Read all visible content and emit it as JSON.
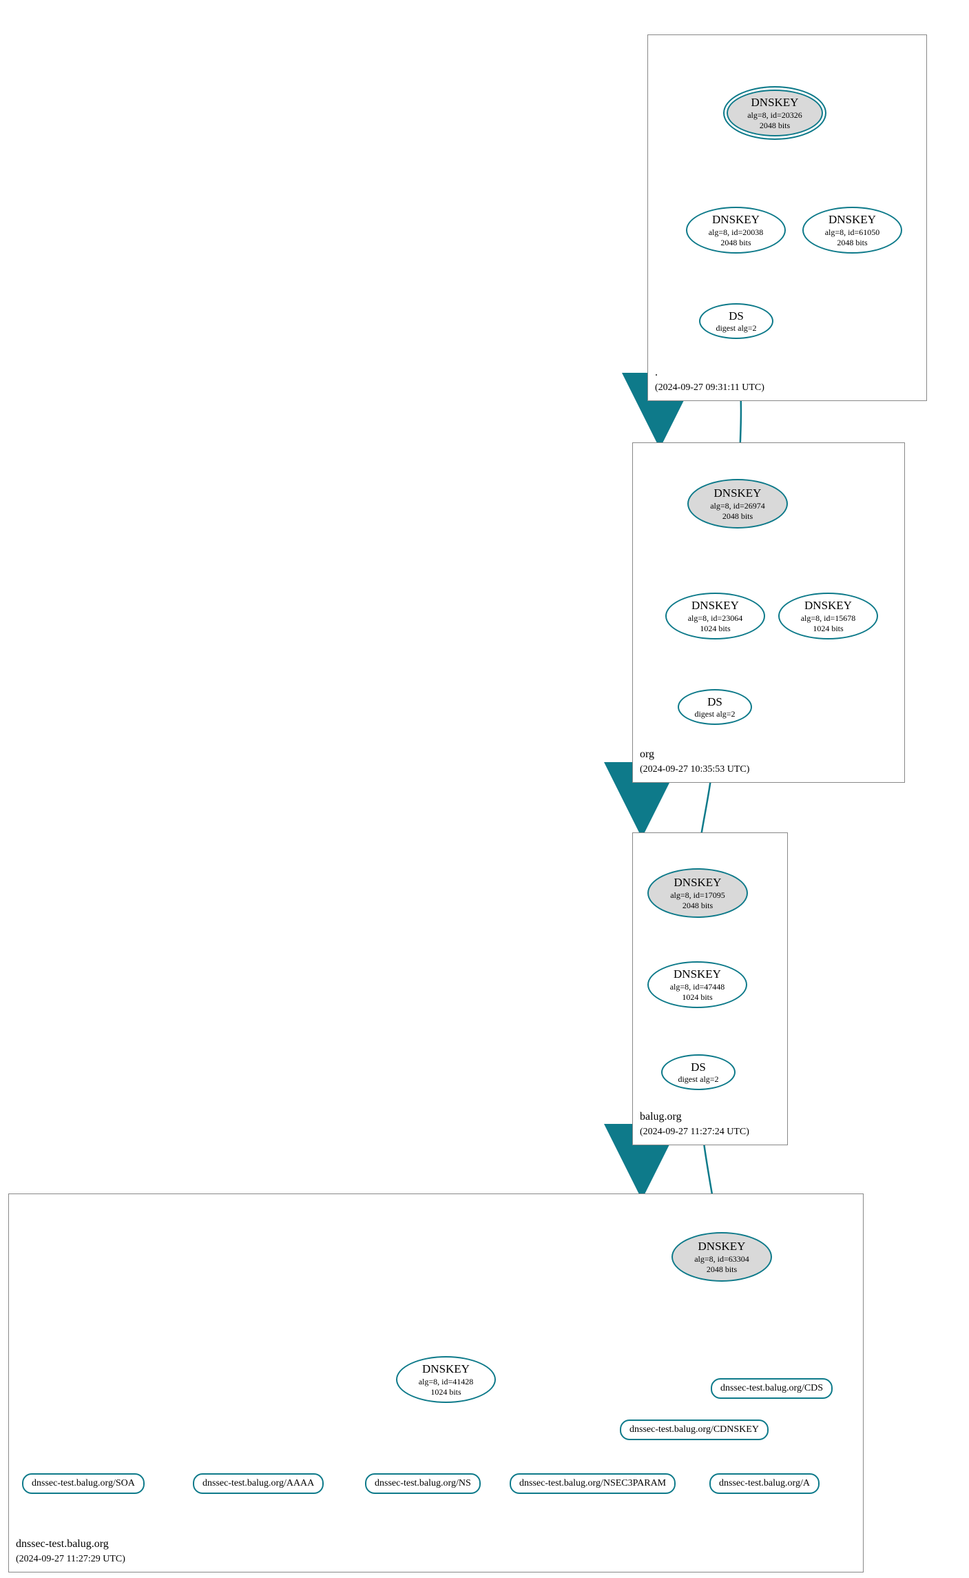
{
  "zones": {
    "root": {
      "name": ".",
      "timestamp": "(2024-09-27 09:31:11 UTC)"
    },
    "org": {
      "name": "org",
      "timestamp": "(2024-09-27 10:35:53 UTC)"
    },
    "balug": {
      "name": "balug.org",
      "timestamp": "(2024-09-27 11:27:24 UTC)"
    },
    "test": {
      "name": "dnssec-test.balug.org",
      "timestamp": "(2024-09-27 11:27:29 UTC)"
    }
  },
  "nodes": {
    "root_ksk": {
      "title": "DNSKEY",
      "line2": "alg=8, id=20326",
      "line3": "2048 bits"
    },
    "root_zsk": {
      "title": "DNSKEY",
      "line2": "alg=8, id=20038",
      "line3": "2048 bits"
    },
    "root_extra": {
      "title": "DNSKEY",
      "line2": "alg=8, id=61050",
      "line3": "2048 bits"
    },
    "root_ds": {
      "title": "DS",
      "line2": "digest alg=2"
    },
    "org_ksk": {
      "title": "DNSKEY",
      "line2": "alg=8, id=26974",
      "line3": "2048 bits"
    },
    "org_zsk": {
      "title": "DNSKEY",
      "line2": "alg=8, id=23064",
      "line3": "1024 bits"
    },
    "org_extra": {
      "title": "DNSKEY",
      "line2": "alg=8, id=15678",
      "line3": "1024 bits"
    },
    "org_ds": {
      "title": "DS",
      "line2": "digest alg=2"
    },
    "balug_ksk": {
      "title": "DNSKEY",
      "line2": "alg=8, id=17095",
      "line3": "2048 bits"
    },
    "balug_zsk": {
      "title": "DNSKEY",
      "line2": "alg=8, id=47448",
      "line3": "1024 bits"
    },
    "balug_ds": {
      "title": "DS",
      "line2": "digest alg=2"
    },
    "test_ksk": {
      "title": "DNSKEY",
      "line2": "alg=8, id=63304",
      "line3": "2048 bits"
    },
    "test_zsk": {
      "title": "DNSKEY",
      "line2": "alg=8, id=41428",
      "line3": "1024 bits"
    },
    "rr_soa": {
      "label": "dnssec-test.balug.org/SOA"
    },
    "rr_aaaa": {
      "label": "dnssec-test.balug.org/AAAA"
    },
    "rr_ns": {
      "label": "dnssec-test.balug.org/NS"
    },
    "rr_nsec3": {
      "label": "dnssec-test.balug.org/NSEC3PARAM"
    },
    "rr_a": {
      "label": "dnssec-test.balug.org/A"
    },
    "rr_cdnskey": {
      "label": "dnssec-test.balug.org/CDNSKEY"
    },
    "rr_cds": {
      "label": "dnssec-test.balug.org/CDS"
    }
  },
  "colors": {
    "edge": "#0e7a8a",
    "edge_light": "#b8b8b8",
    "box": "#888888",
    "warn": "#cc0000"
  }
}
